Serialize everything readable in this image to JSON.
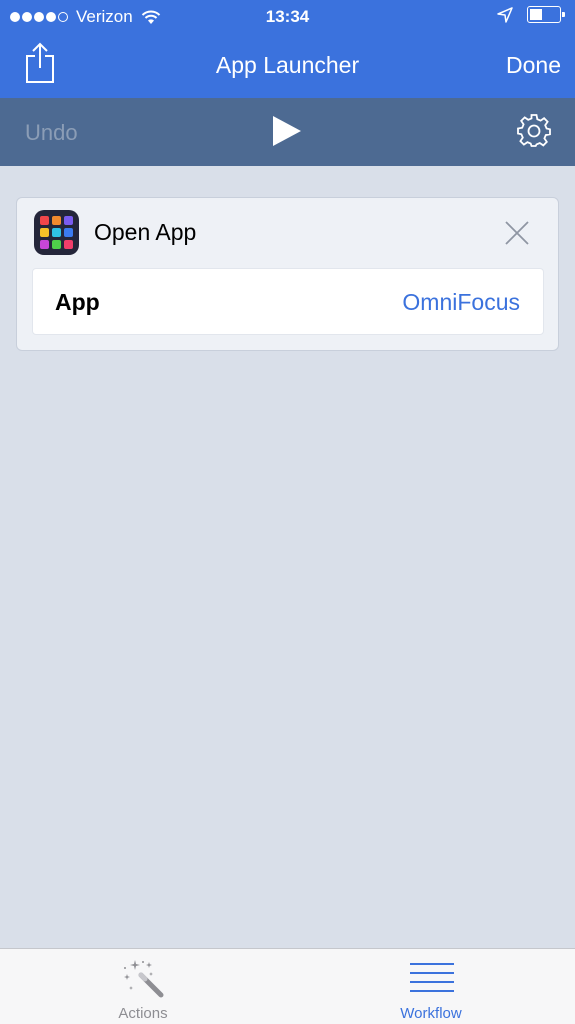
{
  "status_bar": {
    "carrier": "Verizon",
    "time": "13:34",
    "battery_level": 0.45
  },
  "nav": {
    "title": "App Launcher",
    "done_label": "Done"
  },
  "toolbar": {
    "undo_label": "Undo"
  },
  "action_card": {
    "title": "Open App",
    "param_label": "App",
    "param_value": "OmniFocus"
  },
  "tabs": [
    {
      "label": "Actions",
      "icon": "magic-wand-icon",
      "selected": false
    },
    {
      "label": "Workflow",
      "icon": "list-icon",
      "selected": true
    }
  ],
  "colors": {
    "accent": "#3b72dd",
    "toolbar": "#4d6a92",
    "background": "#d9dfe9",
    "disabled": "#8b9db6"
  }
}
